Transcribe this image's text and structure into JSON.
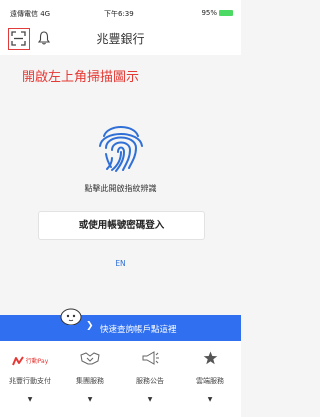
{
  "status": {
    "carrier": "遠傳電信 4G",
    "time": "下午6:39",
    "battery": "95%"
  },
  "header": {
    "title": "兆豐銀行"
  },
  "hint": "開啟左上角掃描圖示",
  "main": {
    "fingerprint_text": "點擊此開啟指紋辨識",
    "login_button": "或使用帳號密碼登入",
    "language": "EN"
  },
  "banner": {
    "label": "快速查詢帳戶點這裡"
  },
  "tabs": [
    {
      "label": "兆豐行動支付",
      "icon": "megapay-icon",
      "badge": "行動Pay"
    },
    {
      "label": "集團服務",
      "icon": "handshake-icon"
    },
    {
      "label": "服務公告",
      "icon": "megaphone-icon"
    },
    {
      "label": "雲端服務",
      "icon": "star-icon"
    }
  ],
  "colors": {
    "accent": "#e53935",
    "banner": "#2f6ff0",
    "link": "#2f6fd6"
  }
}
